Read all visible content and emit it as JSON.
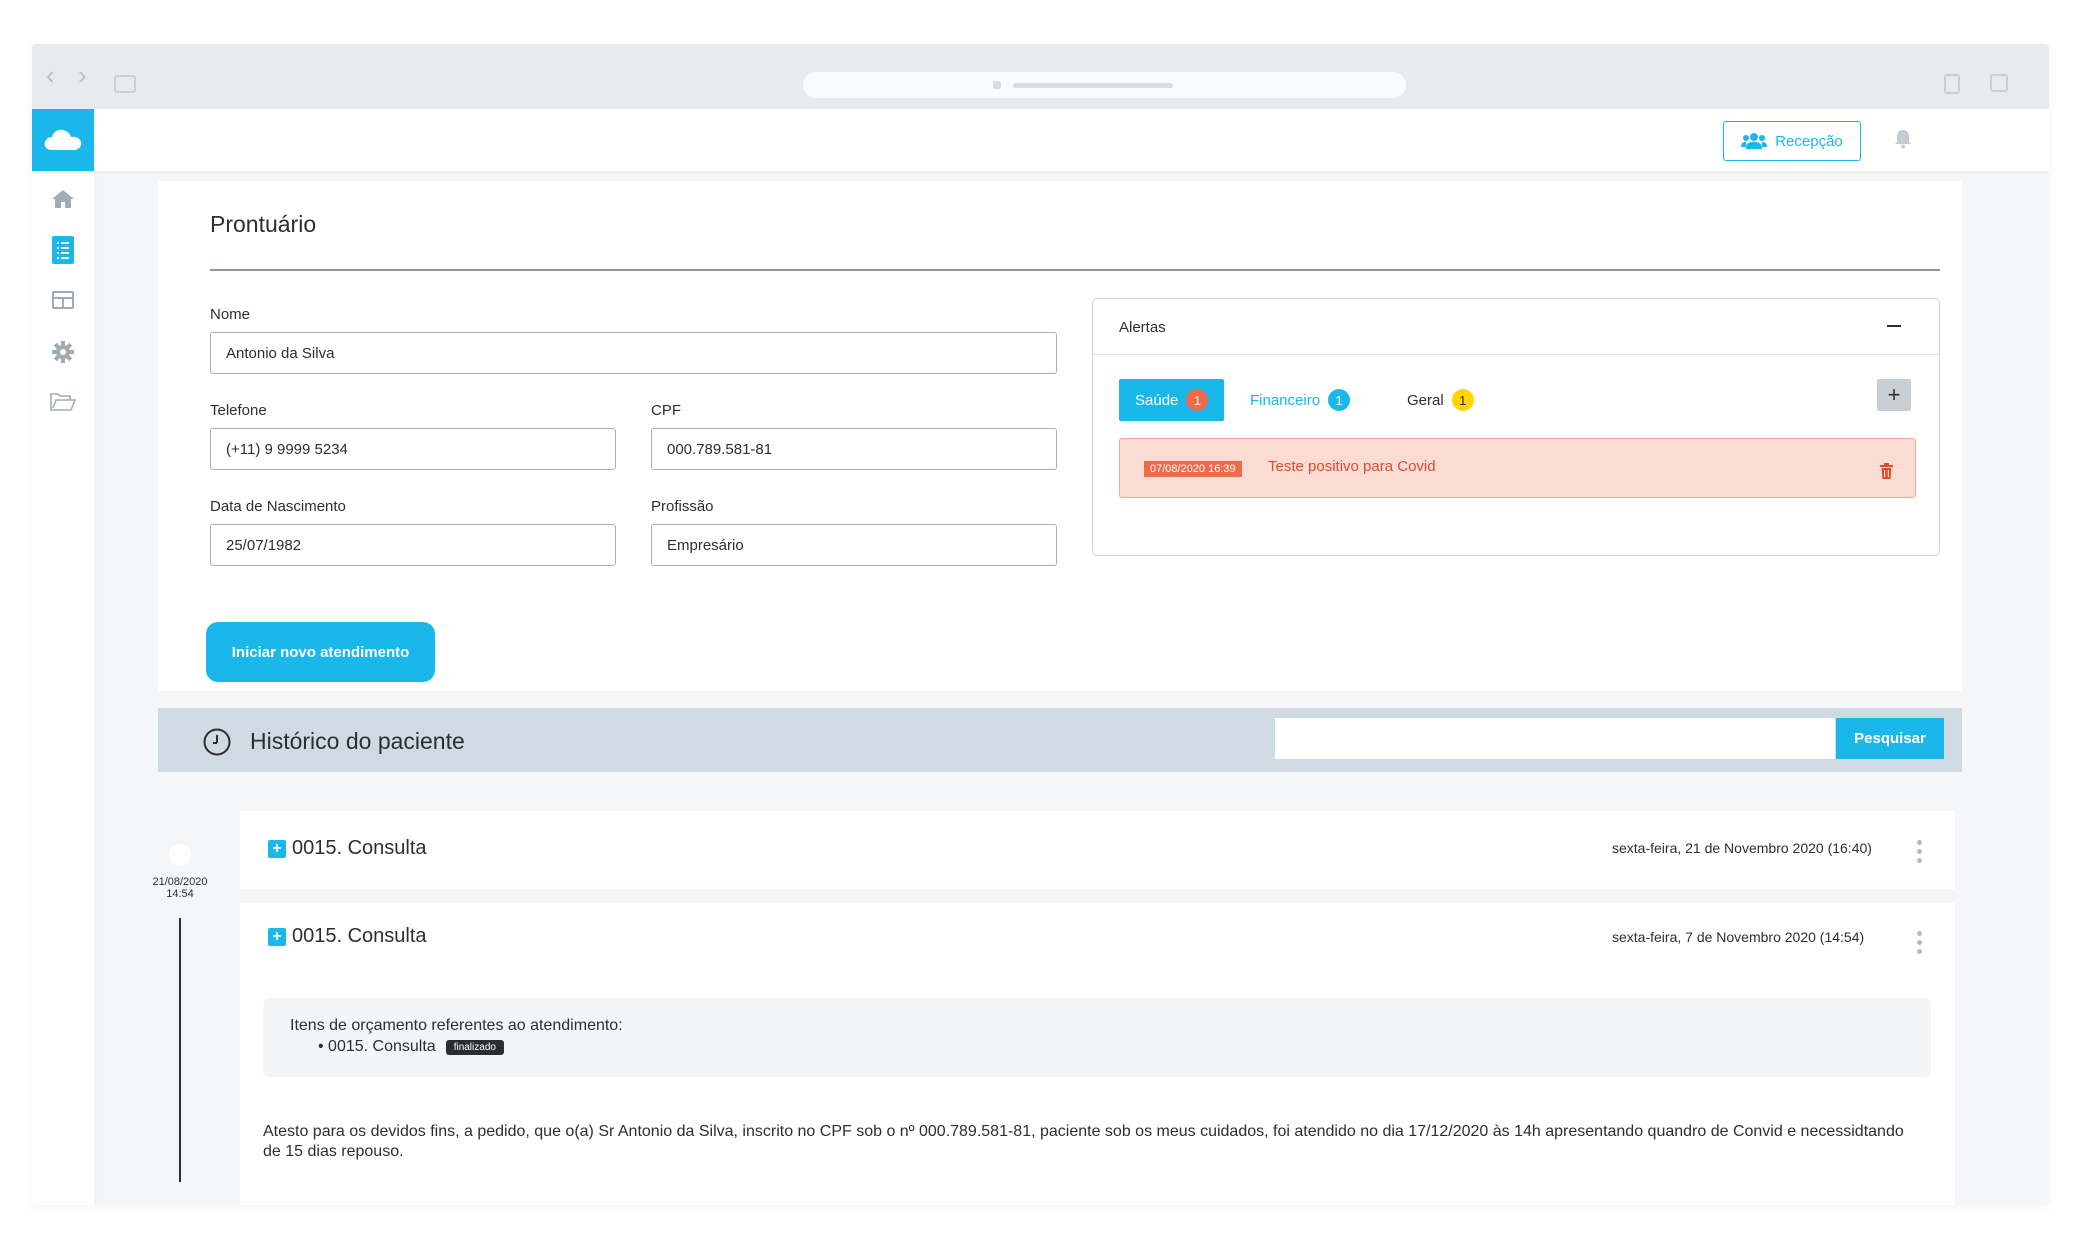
{
  "topbar": {
    "reception_label": "Recepção"
  },
  "sidebar": {
    "items": [
      {
        "icon": "home-icon"
      },
      {
        "icon": "list-icon",
        "active": true
      },
      {
        "icon": "table-icon"
      },
      {
        "icon": "gear-icon"
      },
      {
        "icon": "folder-icon"
      }
    ]
  },
  "record": {
    "title": "Prontuário",
    "fields": {
      "name_label": "Nome",
      "name_value": "Antonio da Silva",
      "phone_label": "Telefone",
      "phone_value": "(+11) 9 9999 5234",
      "cpf_label": "CPF",
      "cpf_value": "000.789.581-81",
      "birth_label": "Data de Nascimento",
      "birth_value": "25/07/1982",
      "profession_label": "Profissão",
      "profession_value": "Empresário"
    },
    "new_button": "Iniciar novo atendimento"
  },
  "alerts": {
    "title": "Alertas",
    "tabs": [
      {
        "label": "Saúde",
        "count": "1",
        "color": "#ef6b4a"
      },
      {
        "label": "Financeiro",
        "count": "1",
        "color": "#1ab8ea"
      },
      {
        "label": "Geral",
        "count": "1",
        "color": "#ffd600"
      }
    ],
    "items": [
      {
        "date": "07/08/2020 16:39",
        "text": "Teste positivo para Covid"
      }
    ]
  },
  "history": {
    "title": "Histórico do paciente",
    "search_button": "Pesquisar",
    "timeline_date": "21/08/2020",
    "timeline_time": "14:54",
    "entries": [
      {
        "title": "0015. Consulta",
        "date": "sexta-feira, 21 de Novembro 2020 (16:40)"
      },
      {
        "title": "0015. Consulta",
        "date": "sexta-feira, 7 de Novembro 2020 (14:54)",
        "budget_header": "Itens de orçamento referentes ao atendimento:",
        "budget_item": "• 0015. Consulta",
        "budget_status": "finalizado",
        "note": "Atesto para os devidos fins, a pedido, que o(a) Sr Antonio da Silva, inscrito no CPF sob o nº 000.789.581-81, paciente sob os meus cuidados, foi atendido no dia 17/12/2020 às 14h apresentando quandro de Convid e necessidtando de 15 dias repouso."
      }
    ]
  },
  "colors": {
    "accent": "#1ab8ea",
    "alert_bg": "#fbdcd4",
    "alert_text": "#e24a2c"
  }
}
